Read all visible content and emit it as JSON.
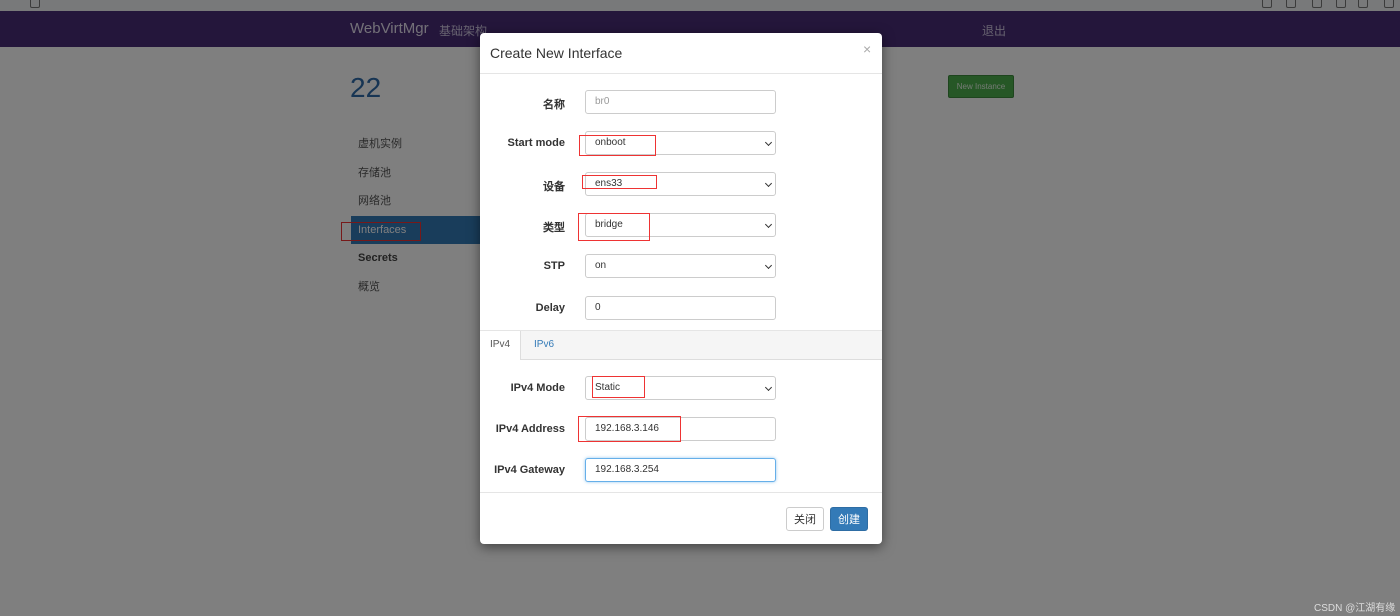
{
  "navbar": {
    "brand": "WebVirtMgr",
    "nav_item": "基础架构",
    "logout": "退出"
  },
  "page": {
    "title": "22",
    "new_instance_label": "New Instance"
  },
  "sidebar": {
    "items": [
      {
        "label": "虚机实例"
      },
      {
        "label": "存储池"
      },
      {
        "label": "网络池"
      },
      {
        "label": "Interfaces",
        "active": true
      },
      {
        "label": "Secrets"
      },
      {
        "label": "概览"
      }
    ]
  },
  "modal": {
    "title": "Create New Interface",
    "close_symbol": "×",
    "fields": {
      "name": {
        "label": "名称",
        "placeholder": "br0"
      },
      "start_mode": {
        "label": "Start mode",
        "value": "onboot"
      },
      "device": {
        "label": "设备",
        "value": "ens33"
      },
      "type": {
        "label": "类型",
        "value": "bridge"
      },
      "stp": {
        "label": "STP",
        "value": "on"
      },
      "delay": {
        "label": "Delay",
        "value": "0"
      }
    },
    "tabs": {
      "ipv4": "IPv4",
      "ipv6": "IPv6",
      "active": "IPv4"
    },
    "ipv4": {
      "mode": {
        "label": "IPv4 Mode",
        "value": "Static"
      },
      "address": {
        "label": "IPv4 Address",
        "value": "192.168.3.146"
      },
      "gateway": {
        "label": "IPv4 Gateway",
        "value": "192.168.3.254"
      }
    },
    "footer": {
      "close_label": "关闭",
      "create_label": "创建"
    }
  },
  "watermark": "CSDN @江湖有缘",
  "colors": {
    "navbar": "#492c77",
    "primary": "#337ab7",
    "success": "#4cae4c",
    "highlight": "#e33333"
  }
}
